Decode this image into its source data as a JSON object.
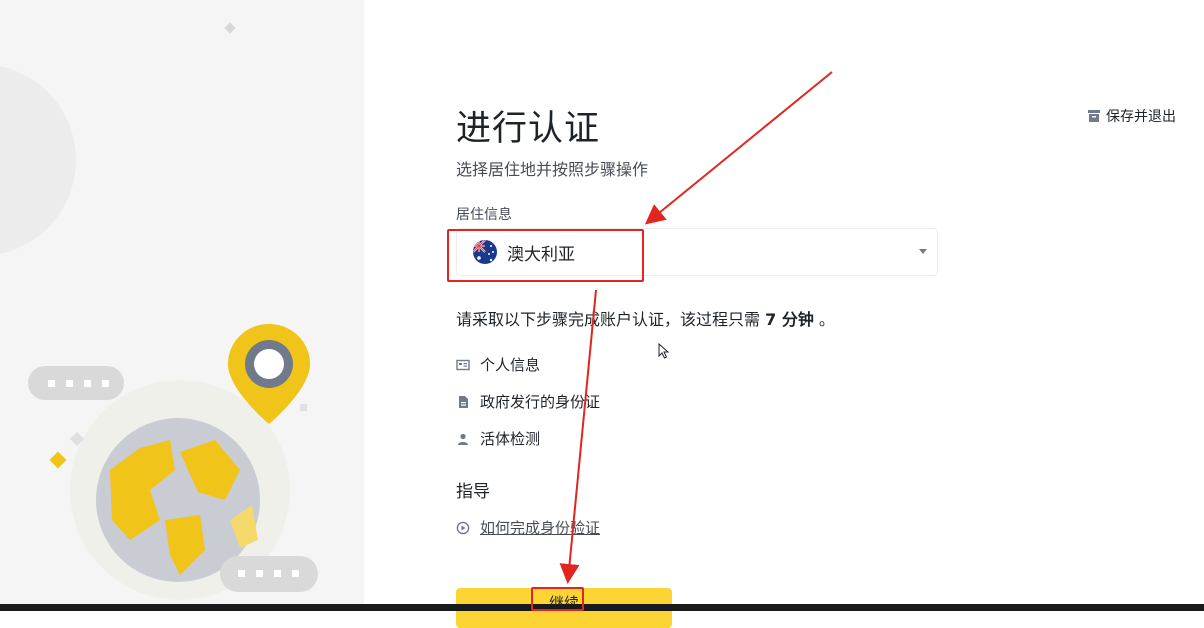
{
  "page": {
    "title": "进行认证",
    "subtitle": "选择居住地并按照步骤操作",
    "save_exit_label": "保存并退出"
  },
  "residence": {
    "label": "居住信息",
    "selected_country": "澳大利亚",
    "flag_icon": "australia-flag-icon"
  },
  "steps": {
    "intro_prefix": "请采取以下步骤完成账户认证，该过程只需",
    "intro_duration": "7 分钟",
    "intro_suffix": "。",
    "items": [
      {
        "label": "个人信息",
        "icon": "id-card-icon"
      },
      {
        "label": "政府发行的身份证",
        "icon": "document-icon"
      },
      {
        "label": "活体检测",
        "icon": "person-icon"
      }
    ]
  },
  "guide": {
    "title": "指导",
    "link_label": "如何完成身份验证",
    "link_icon": "play-circle-icon"
  },
  "actions": {
    "continue_label": "继续"
  },
  "colors": {
    "accent": "#fcd535",
    "annotation": "#e0261e",
    "text": "#1e2329",
    "muted": "#474d57"
  }
}
